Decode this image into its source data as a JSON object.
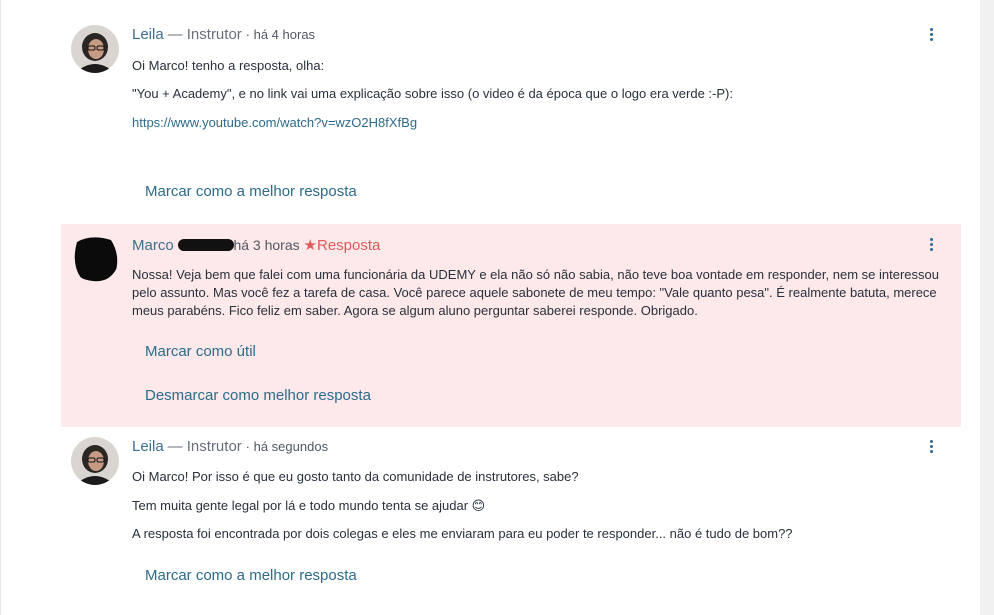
{
  "posts": [
    {
      "author": "Leila",
      "role": "— Instrutor",
      "time": "· há 4 horas",
      "lines": [
        "Oi Marco! tenho a resposta, olha:",
        "\"You + Academy\", e no link vai uma explicação sobre isso (o video é da época que o logo era verde :-P):"
      ],
      "link": "https://www.youtube.com/watch?v=wzO2H8fXfBg",
      "action": "Marcar como a melhor resposta"
    },
    {
      "author": "Marco",
      "time": "há 3 horas",
      "badge": "Resposta",
      "text": "Nossa! Veja bem que falei com uma funcionária da UDEMY e ela não só não sabia, não teve boa vontade em responder, nem se interessou pelo assunto. Mas você fez a tarefa de casa. Você parece aquele sabonete de meu tempo: \"Vale quanto pesa\". É realmente batuta, merece meus parabéns. Fico feliz em saber. Agora se algum aluno perguntar saberei responde. Obrigado.",
      "action_useful": "Marcar como útil",
      "action_unmark": "Desmarcar como melhor resposta"
    },
    {
      "author": "Leila",
      "role": "— Instrutor",
      "time": "· há segundos",
      "lines": [
        "Oi Marco! Por isso é que eu gosto tanto da comunidade de instrutores, sabe?",
        "Tem muita gente legal por lá e todo mundo tenta se ajudar 😊",
        "A resposta foi encontrada por dois colegas e eles me enviaram para eu poder te responder... não é tudo de bom??"
      ],
      "action": "Marcar como a melhor resposta"
    }
  ],
  "icons": {
    "menu": "kebab-menu-icon",
    "star": "star-icon",
    "emoji": "smiling-face-emoji"
  },
  "colors": {
    "highlight_bg": "#fde9e9",
    "link": "#2d6b8a",
    "badge": "#e2585a"
  }
}
